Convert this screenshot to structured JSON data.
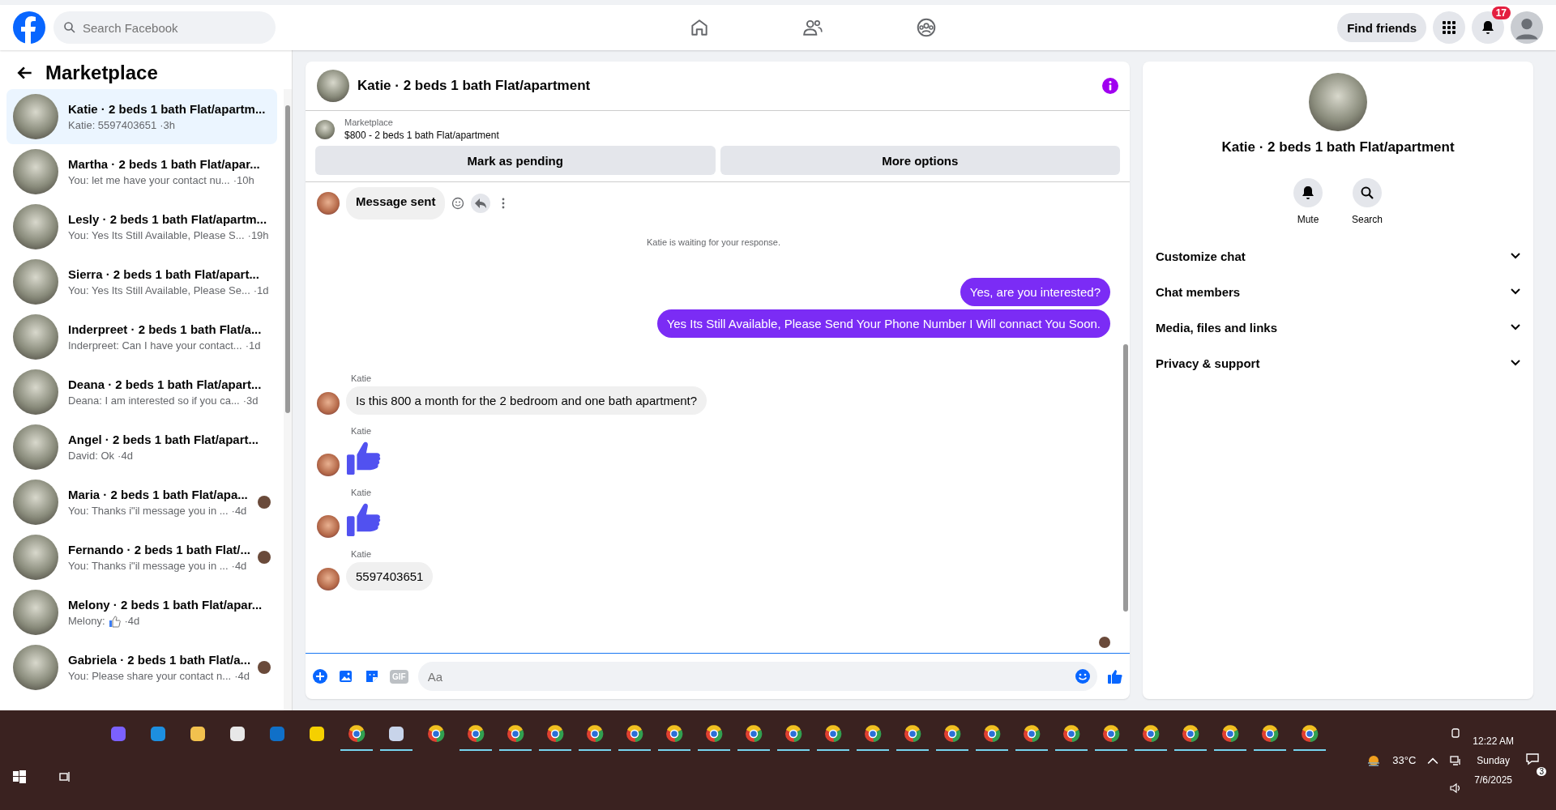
{
  "topbar": {
    "search": {
      "placeholder": "Search Facebook"
    },
    "find_friends": "Find friends",
    "notification_count": "17"
  },
  "sidebar": {
    "title": "Marketplace",
    "chats": [
      {
        "title": "Katie · 2 beds 1 bath Flat/apartm...",
        "preview": "Katie: 5597403651",
        "time": "·3h",
        "selected": true,
        "seen_avatar": false,
        "like_icon": false
      },
      {
        "title": "Martha · 2 beds 1 bath Flat/apar...",
        "preview": "You: let me have your contact nu...",
        "time": "·10h",
        "selected": false,
        "seen_avatar": false,
        "like_icon": false
      },
      {
        "title": "Lesly · 2 beds 1 bath Flat/apartm...",
        "preview": "You: Yes Its Still Available, Please S...",
        "time": "·19h",
        "selected": false,
        "seen_avatar": false,
        "like_icon": false
      },
      {
        "title": "Sierra · 2 beds 1 bath Flat/apart...",
        "preview": "You: Yes Its Still Available, Please Se...",
        "time": "·1d",
        "selected": false,
        "seen_avatar": false,
        "like_icon": false
      },
      {
        "title": "Inderpreet · 2 beds 1 bath Flat/a...",
        "preview": "Inderpreet: Can I have your contact...",
        "time": "·1d",
        "selected": false,
        "seen_avatar": false,
        "like_icon": false
      },
      {
        "title": "Deana · 2 beds 1 bath Flat/apart...",
        "preview": "Deana: I am interested so if you ca...",
        "time": "·3d",
        "selected": false,
        "seen_avatar": false,
        "like_icon": false
      },
      {
        "title": "Angel · 2 beds 1 bath Flat/apart...",
        "preview": "David: Ok",
        "time": "·4d",
        "selected": false,
        "seen_avatar": false,
        "like_icon": false
      },
      {
        "title": "Maria · 2 beds 1 bath Flat/apa...",
        "preview": "You: Thanks i\"il message you in ...",
        "time": "·4d",
        "selected": false,
        "seen_avatar": true,
        "like_icon": false
      },
      {
        "title": "Fernando · 2 beds 1 bath Flat/...",
        "preview": "You: Thanks i\"il message you in ...",
        "time": "·4d",
        "selected": false,
        "seen_avatar": true,
        "like_icon": false
      },
      {
        "title": "Melony · 2 beds 1 bath Flat/apar...",
        "preview": "Melony:",
        "time": "·4d",
        "selected": false,
        "seen_avatar": false,
        "like_icon": true
      },
      {
        "title": "Gabriela · 2 beds 1 bath Flat/a...",
        "preview": "You: Please share your contact n...",
        "time": "·4d",
        "selected": false,
        "seen_avatar": true,
        "like_icon": false
      }
    ]
  },
  "chat": {
    "title": "Katie · 2 beds 1 bath Flat/apartment",
    "listing": {
      "source": "Marketplace",
      "text": "$800 - 2 beds 1 bath Flat/apartment"
    },
    "buttons": [
      "Mark as pending",
      "More options"
    ],
    "messages": [
      {
        "kind": "status",
        "text": "Message sent"
      },
      {
        "kind": "notice",
        "text": "Katie is waiting for your response."
      },
      {
        "kind": "outgoing",
        "text": "Yes, are you interested?"
      },
      {
        "kind": "outgoing",
        "text": "Yes Its Still Available, Please Send Your Phone Number I Will connact You Soon."
      },
      {
        "kind": "incoming",
        "sender": "Katie",
        "text": "Is this 800 a month for the 2 bedroom and one bath apartment?"
      },
      {
        "kind": "like",
        "sender": "Katie"
      },
      {
        "kind": "like",
        "sender": "Katie"
      },
      {
        "kind": "incoming",
        "sender": "Katie",
        "text": "5597403651"
      }
    ],
    "composer": {
      "gif": "GIF",
      "placeholder": "Aa"
    }
  },
  "details": {
    "title": "Katie · 2 beds 1 bath Flat/apartment",
    "actions": [
      "Mute",
      "Search"
    ],
    "sections": [
      "Customize chat",
      "Chat members",
      "Media, files and links",
      "Privacy & support"
    ]
  },
  "taskbar": {
    "apps": [
      {
        "kind": "copilot",
        "running": false
      },
      {
        "kind": "edge",
        "running": false
      },
      {
        "kind": "folder",
        "running": false
      },
      {
        "kind": "store",
        "running": false
      },
      {
        "kind": "mail",
        "running": false
      },
      {
        "kind": "note",
        "running": false
      },
      {
        "kind": "browser",
        "running": true
      },
      {
        "kind": "paint",
        "running": true
      },
      {
        "kind": "browser",
        "running": false
      },
      {
        "kind": "browser",
        "running": true
      },
      {
        "kind": "browser",
        "running": true
      },
      {
        "kind": "browser",
        "running": true
      },
      {
        "kind": "browser",
        "running": true
      },
      {
        "kind": "browser",
        "running": true
      },
      {
        "kind": "browser",
        "running": true
      },
      {
        "kind": "browser",
        "running": true
      },
      {
        "kind": "browser",
        "running": true
      },
      {
        "kind": "browser",
        "running": true
      },
      {
        "kind": "browser",
        "running": true
      },
      {
        "kind": "browser",
        "running": true
      },
      {
        "kind": "browser",
        "running": true
      },
      {
        "kind": "browser",
        "running": true
      },
      {
        "kind": "browser",
        "running": true
      },
      {
        "kind": "browser",
        "running": true
      },
      {
        "kind": "browser",
        "running": true
      },
      {
        "kind": "browser",
        "running": true
      },
      {
        "kind": "browser",
        "running": true
      },
      {
        "kind": "browser",
        "running": true
      },
      {
        "kind": "browser",
        "running": true
      },
      {
        "kind": "browser",
        "running": true
      },
      {
        "kind": "browser",
        "running": true
      }
    ],
    "temperature": "33°C",
    "time": "12:22 AM",
    "day": "Sunday",
    "date": "7/6/2025",
    "notification_count": "3"
  }
}
